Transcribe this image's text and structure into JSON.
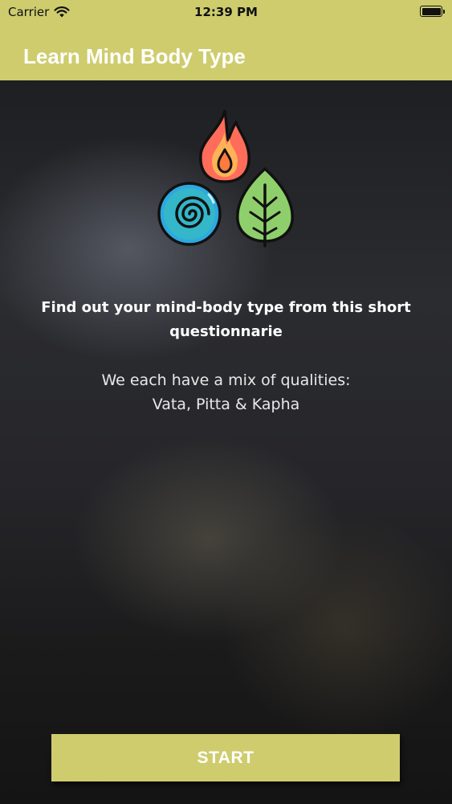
{
  "status_bar": {
    "carrier": "Carrier",
    "time": "12:39 PM"
  },
  "nav": {
    "title": "Learn Mind Body Type"
  },
  "main": {
    "logo_icons": [
      "fire-icon",
      "air-spiral-icon",
      "leaf-icon"
    ],
    "headline": "Find out your mind-body type from this short questionnarie",
    "subtext_line1": "We each have a mix of qualities:",
    "subtext_line2": "Vata, Pitta & Kapha",
    "start_label": "START"
  },
  "colors": {
    "accent": "#cfcc6e",
    "background": "#1e1f22",
    "text": "#ffffff"
  }
}
